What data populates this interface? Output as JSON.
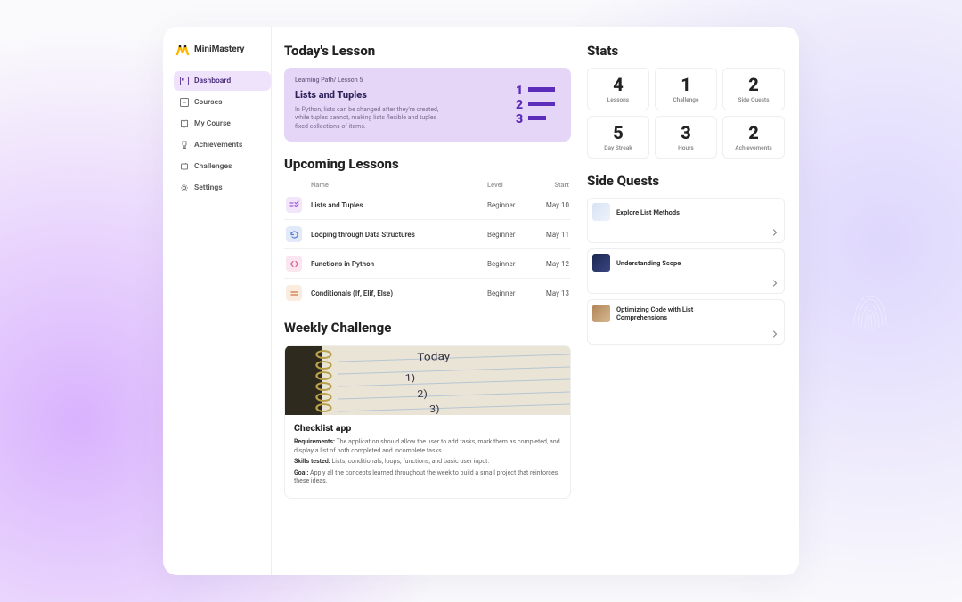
{
  "brand": {
    "name": "MiniMastery"
  },
  "nav": {
    "items": [
      {
        "label": "Dashboard",
        "active": true
      },
      {
        "label": "Courses",
        "active": false
      },
      {
        "label": "My Course",
        "active": false
      },
      {
        "label": "Achievements",
        "active": false
      },
      {
        "label": "Challenges",
        "active": false
      },
      {
        "label": "Settings",
        "active": false
      }
    ]
  },
  "today": {
    "heading": "Today's Lesson",
    "crumb": "Learning Path/ Lesson 5",
    "title": "Lists and Tuples",
    "desc": "In Python, lists can be changed after they're created, while tuples cannot, making lists flexible and tuples fixed collections of items."
  },
  "upcoming": {
    "heading": "Upcoming Lessons",
    "columns": {
      "name": "Name",
      "level": "Level",
      "start": "Start"
    },
    "rows": [
      {
        "icon": "checklist-icon",
        "name": "Lists and Tuples",
        "level": "Beginner",
        "start": "May 10"
      },
      {
        "icon": "loop-icon",
        "name": "Looping through Data Structures",
        "level": "Beginner",
        "start": "May 11"
      },
      {
        "icon": "code-icon",
        "name": "Functions in Python",
        "level": "Beginner",
        "start": "May 12"
      },
      {
        "icon": "equals-icon",
        "name": "Conditionals (If, Elif, Else)",
        "level": "Beginner",
        "start": "May 13"
      }
    ]
  },
  "weekly": {
    "heading": "Weekly Challenge",
    "title": "Checklist app",
    "req_label": "Requirements:",
    "req_text": " The application should allow the user to add tasks, mark them as completed, and display a list of both completed and incomplete tasks.",
    "skills_label": "Skills tested:",
    "skills_text": " Lists, conditionals, loops, functions, and basic user input.",
    "goal_label": "Goal:",
    "goal_text": " Apply all the concepts learned throughout the week to build a small project that reinforces these ideas."
  },
  "stats": {
    "heading": "Stats",
    "items": [
      {
        "value": "4",
        "label": "Lessons"
      },
      {
        "value": "1",
        "label": "Challenge"
      },
      {
        "value": "2",
        "label": "Side Quests"
      },
      {
        "value": "5",
        "label": "Day Streak"
      },
      {
        "value": "3",
        "label": "Hours"
      },
      {
        "value": "2",
        "label": "Achievements"
      }
    ]
  },
  "quests": {
    "heading": "Side Quests",
    "items": [
      {
        "title": "Explore List Methods"
      },
      {
        "title": "Understanding Scope"
      },
      {
        "title": "Optimizing Code with List Comprehensions"
      }
    ]
  }
}
